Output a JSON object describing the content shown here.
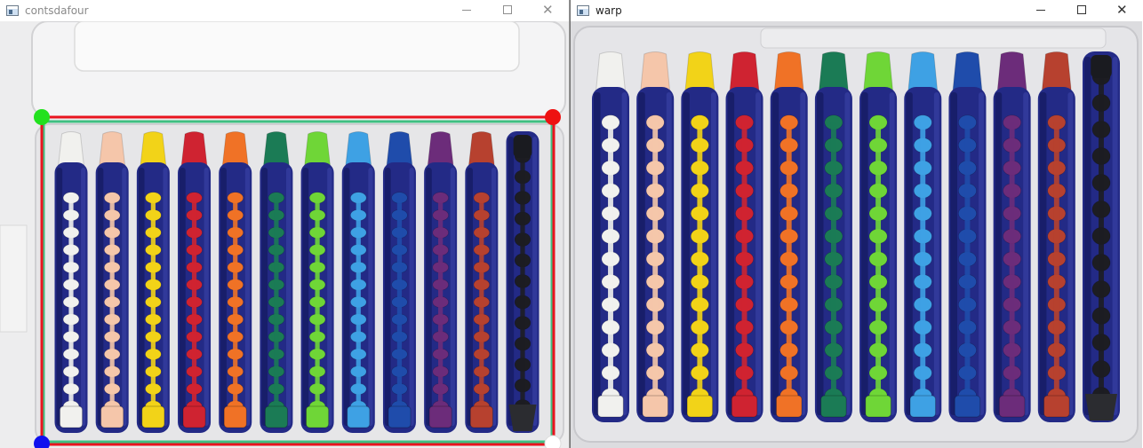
{
  "windows": {
    "left": {
      "title": "contsdafour",
      "icon": "app-window-icon",
      "controls": [
        "minimize-icon",
        "maximize-icon",
        "close-icon"
      ]
    },
    "right": {
      "title": "warp",
      "icon": "app-window-icon",
      "controls": [
        "minimize-icon",
        "maximize-icon",
        "close-icon"
      ]
    }
  },
  "crayons": [
    {
      "color": "#f1f1ee"
    },
    {
      "color": "#f5c6aa"
    },
    {
      "color": "#f2d318"
    },
    {
      "color": "#cf2331"
    },
    {
      "color": "#f07226"
    },
    {
      "color": "#1b7b55"
    },
    {
      "color": "#6fd637"
    },
    {
      "color": "#3ea1e4"
    },
    {
      "color": "#1f4cab"
    },
    {
      "color": "#6c2c7a"
    },
    {
      "color": "#b7412f"
    },
    {
      "color": "#1d1d22"
    }
  ],
  "palette": {
    "holder": "#232a86",
    "holder_shade": "#141a5e",
    "tray": "#e6e6e8",
    "contour_red": "#e8141e",
    "contour_green": "#3fbf82",
    "corner_top_left": "#22e11e",
    "corner_top_right": "#ee1111",
    "corner_bottom_left": "#1010ee",
    "corner_bottom_right": "#ffffff"
  }
}
